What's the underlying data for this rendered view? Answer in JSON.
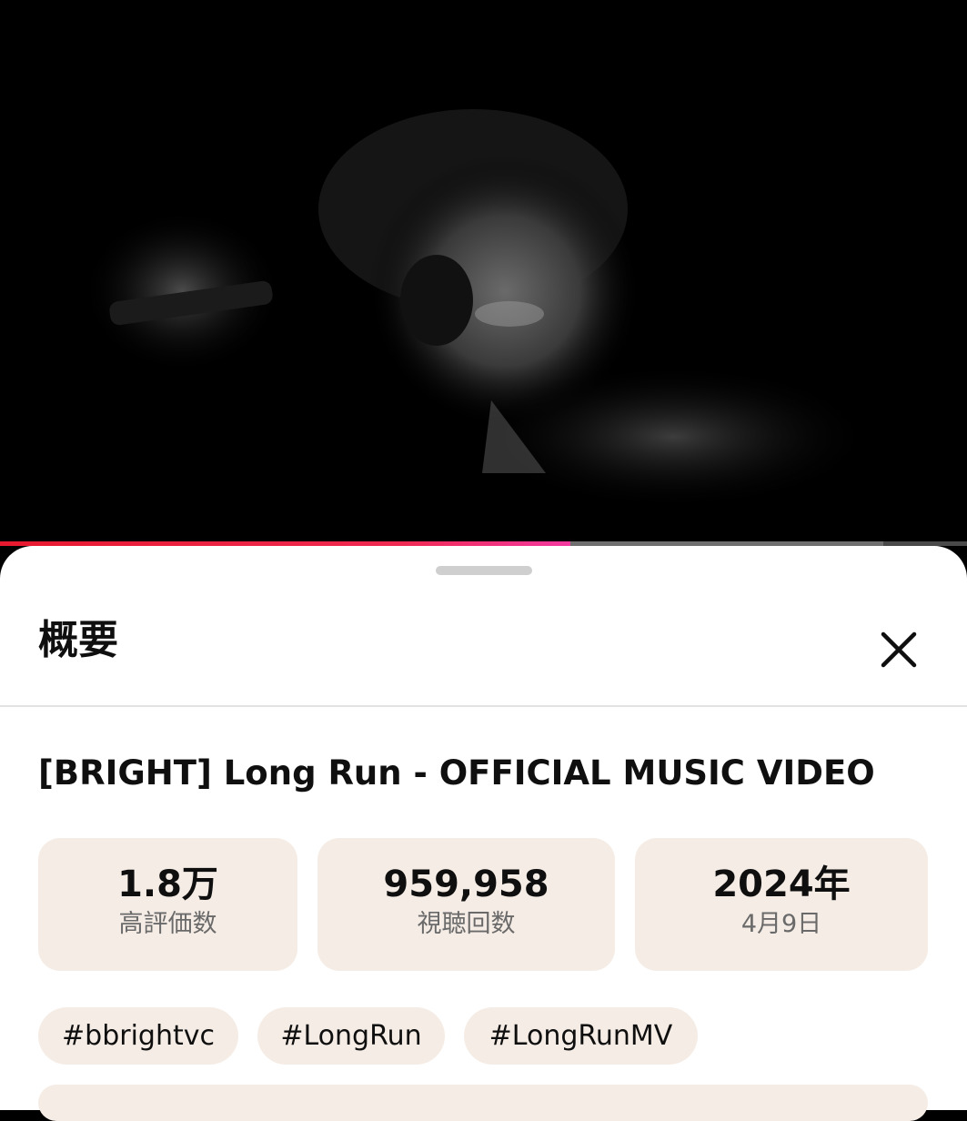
{
  "player": {
    "progress_fraction": 0.59,
    "progress_color": "#ee2a4f"
  },
  "sheet": {
    "title": "概要",
    "close_icon": "close-icon"
  },
  "video": {
    "title": "[BRIGHT] Long Run - OFFICIAL MUSIC VIDEO"
  },
  "stats": [
    {
      "value": "1.8万",
      "label": "高評価数"
    },
    {
      "value": "959,958",
      "label": "視聴回数"
    },
    {
      "value": "2024年",
      "label": "4月9日"
    }
  ],
  "tags": [
    "#bbrightvc",
    "#LongRun",
    "#LongRunMV"
  ],
  "colors": {
    "chip_background": "#f5ece5",
    "text_primary": "#0f0f0f",
    "text_secondary": "#6a6a6a"
  }
}
